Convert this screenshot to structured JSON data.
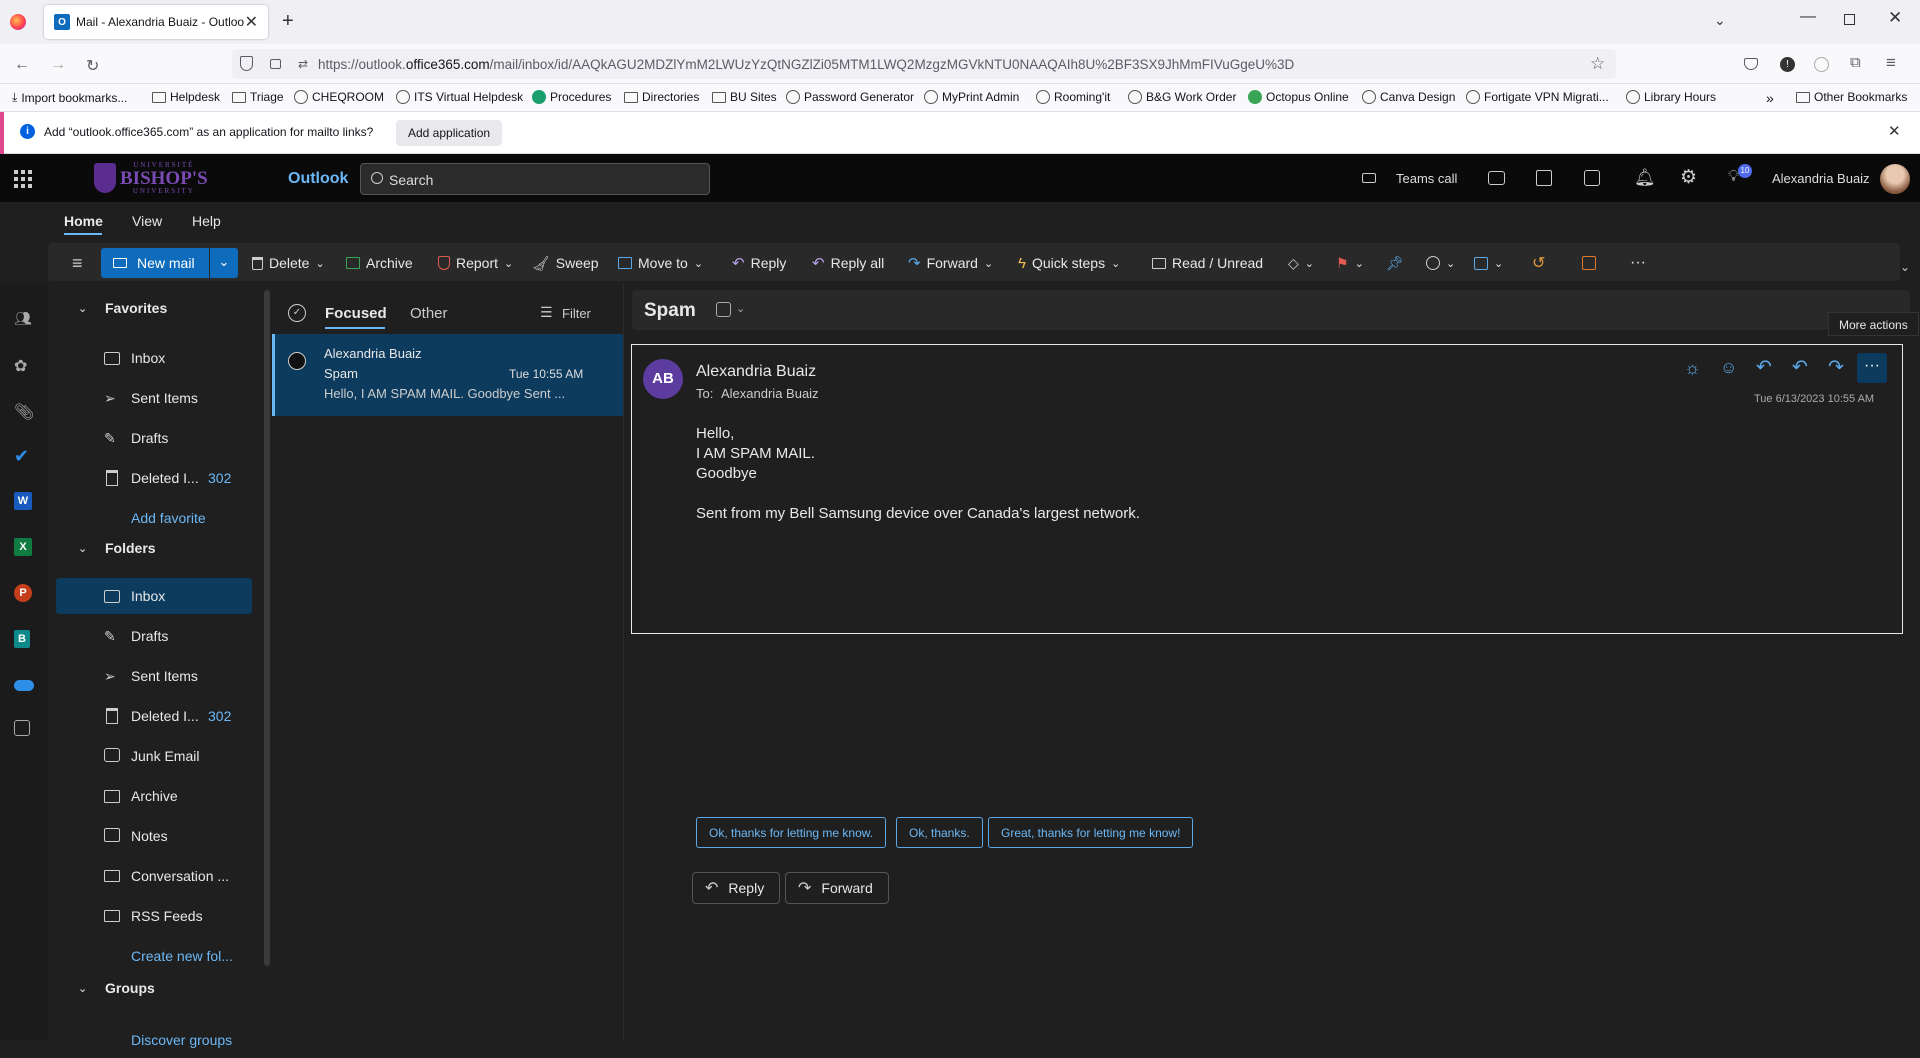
{
  "browser": {
    "tab_title": "Mail - Alexandria Buaiz - Outloo",
    "url_prefix": "https://outlook.",
    "url_domain": "office365.com",
    "url_rest": "/mail/inbox/id/AAQkAGU2MDZlYmM2LWUzYzQtNGZlZi05MTM1LWQ2MzgzMGVkNTU0NAAQAIh8U%2BF3SX9JhMmFIVuGgeU%3D",
    "bookmarks": [
      "Import bookmarks...",
      "Helpdesk",
      "Triage",
      "CHEQROOM",
      "ITS Virtual Helpdesk",
      "Procedures",
      "Directories",
      "BU Sites",
      "Password Generator",
      "MyPrint Admin",
      "Rooming'it",
      "B&G Work Order",
      "Octopus Online",
      "Canva Design",
      "Fortigate VPN Migrati...",
      "Library Hours"
    ],
    "other_bookmarks": "Other Bookmarks",
    "notification_text": "Add “outlook.office365.com” as an application for mailto links?",
    "notification_button": "Add application"
  },
  "header": {
    "logo_line1": "UNIVERSITÉ",
    "logo_line2": "BISHOP'S",
    "logo_line3": "UNIVERSITY",
    "app_name": "Outlook",
    "search_placeholder": "Search",
    "teams_call": "Teams call",
    "badge_count": "10",
    "user_name": "Alexandria Buaiz"
  },
  "ribbon": {
    "tabs": [
      "Home",
      "View",
      "Help"
    ],
    "new_mail": "New mail",
    "delete": "Delete",
    "archive": "Archive",
    "report": "Report",
    "sweep": "Sweep",
    "move_to": "Move to",
    "reply": "Reply",
    "reply_all": "Reply all",
    "forward": "Forward",
    "quick_steps": "Quick steps",
    "read_unread": "Read / Unread"
  },
  "folders": {
    "favorites_label": "Favorites",
    "favorites": [
      {
        "label": "Inbox",
        "count": ""
      },
      {
        "label": "Sent Items",
        "count": ""
      },
      {
        "label": "Drafts",
        "count": ""
      },
      {
        "label": "Deleted I...",
        "count": "302"
      }
    ],
    "add_favorite": "Add favorite",
    "folders_label": "Folders",
    "items": [
      {
        "label": "Inbox",
        "count": ""
      },
      {
        "label": "Drafts",
        "count": ""
      },
      {
        "label": "Sent Items",
        "count": ""
      },
      {
        "label": "Deleted I...",
        "count": "302"
      },
      {
        "label": "Junk Email",
        "count": ""
      },
      {
        "label": "Archive",
        "count": ""
      },
      {
        "label": "Notes",
        "count": ""
      },
      {
        "label": "Conversation ...",
        "count": ""
      },
      {
        "label": "RSS Feeds",
        "count": ""
      }
    ],
    "create_new_folder": "Create new fol...",
    "groups_label": "Groups",
    "discover_groups": "Discover groups"
  },
  "message_list": {
    "tab_focused": "Focused",
    "tab_other": "Other",
    "filter": "Filter",
    "messages": [
      {
        "sender": "Alexandria Buaiz",
        "subject": "Spam",
        "time": "Tue 10:55 AM",
        "preview": "Hello, I AM SPAM MAIL. Goodbye Sent ..."
      }
    ]
  },
  "reading": {
    "subject": "Spam",
    "tooltip": "More actions",
    "avatar_initials": "AB",
    "sender": "Alexandria Buaiz",
    "to_label": "To:",
    "to_name": "Alexandria Buaiz",
    "date": "Tue 6/13/2023 10:55 AM",
    "body_lines": [
      "Hello,",
      "I AM SPAM MAIL.",
      "Goodbye"
    ],
    "signature": "Sent from my Bell Samsung device over Canada's largest network.",
    "suggested_replies": [
      "Ok, thanks for letting me know.",
      "Ok, thanks.",
      "Great, thanks for letting me know!"
    ],
    "reply_button": "Reply",
    "forward_button": "Forward"
  },
  "colors": {
    "accent": "#0f6cbd",
    "link": "#6cb8f6",
    "selected": "#0c3b5e",
    "brand_purple": "#5c2d91"
  }
}
